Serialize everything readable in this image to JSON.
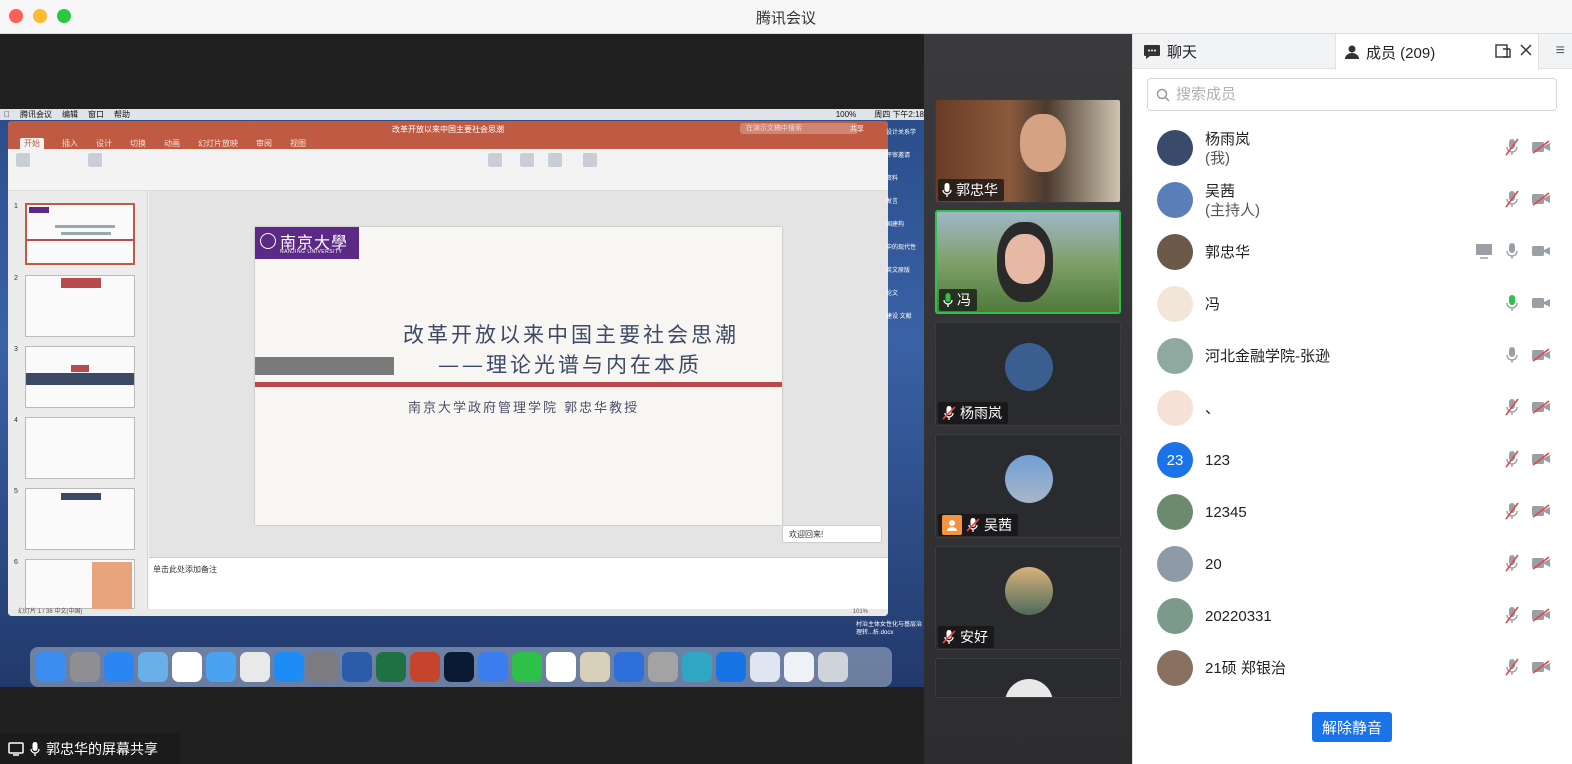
{
  "window": {
    "title": "腾讯会议"
  },
  "share": {
    "label": "郭忠华的屏幕共享"
  },
  "mac_menubar": {
    "items": [
      "腾讯会议",
      "编辑",
      "窗口",
      "帮助"
    ],
    "clock": "周四 下午2:18",
    "battery": "100%"
  },
  "ppt": {
    "doc_title": "改革开放以来中国主要社会思潮",
    "search_placeholder": "在演示文稿中搜索",
    "share_label": "共享",
    "tabs": [
      "开始",
      "插入",
      "设计",
      "切换",
      "动画",
      "幻灯片放映",
      "审阅",
      "视图"
    ],
    "slide": {
      "logo_cn": "南京大學",
      "logo_en": "NANJING UNIVERSITY",
      "title_line1": "改革开放以来中国主要社会思潮",
      "title_line2": "——理论光谱与内在本质",
      "subtitle": "南京大学政府管理学院  郭忠华教授"
    },
    "thumb_numbers": [
      "1",
      "2",
      "3",
      "4",
      "5",
      "6"
    ],
    "notes_placeholder": "单击此处添加备注",
    "status": "幻灯片 1 / 36    中文(中国)",
    "zoom": "101%",
    "welcome": "欢迎回来!",
    "desktop_files": [
      "设计关系学",
      "评审邀请",
      "资料",
      "发言",
      "国建构",
      "中的现代性",
      "英文原版",
      "论文",
      "建设 文献",
      "村治主体女性化与基层治理转...析.docx"
    ]
  },
  "videos": [
    {
      "name": "郭忠华",
      "mic": "on",
      "speaking": false,
      "host_badge": false
    },
    {
      "name": "冯",
      "mic": "on",
      "speaking": true,
      "host_badge": false
    },
    {
      "name": "杨雨岚",
      "mic": "off",
      "speaking": false,
      "host_badge": false
    },
    {
      "name": "吴茜",
      "mic": "off",
      "speaking": false,
      "host_badge": true
    },
    {
      "name": "安好",
      "mic": "off",
      "speaking": false,
      "host_badge": false
    }
  ],
  "panel": {
    "chat_tab": "聊天",
    "members_tab": "成员 (209)",
    "search_placeholder": "搜索成员",
    "unmute_button": "解除静音",
    "members": [
      {
        "name": "杨雨岚",
        "sub": "(我)",
        "mic": "off",
        "cam": "off",
        "share": false
      },
      {
        "name": "吴茜",
        "sub": "(主持人)",
        "mic": "off",
        "cam": "off",
        "share": false
      },
      {
        "name": "郭忠华",
        "sub": "",
        "mic": "on",
        "cam": "on",
        "share": true
      },
      {
        "name": "冯",
        "sub": "",
        "mic": "active",
        "cam": "on",
        "share": false
      },
      {
        "name": "河北金融学院-张逊",
        "sub": "",
        "mic": "on",
        "cam": "off",
        "share": false
      },
      {
        "name": "、",
        "sub": "",
        "mic": "off",
        "cam": "off",
        "share": false
      },
      {
        "name": "123",
        "sub": "",
        "mic": "off",
        "cam": "off",
        "share": false,
        "avatar_text": "23"
      },
      {
        "name": "12345",
        "sub": "",
        "mic": "off",
        "cam": "off",
        "share": false
      },
      {
        "name": "20",
        "sub": "",
        "mic": "off",
        "cam": "off",
        "share": false
      },
      {
        "name": "20220331",
        "sub": "",
        "mic": "off",
        "cam": "off",
        "share": false
      },
      {
        "name": "21硕 郑银治",
        "sub": "",
        "mic": "off",
        "cam": "off",
        "share": false
      }
    ]
  },
  "colors": {
    "accent": "#1a73e8",
    "speaking": "#2fc24a",
    "ppt": "#c05b43",
    "nju_purple": "#5b2a86"
  }
}
